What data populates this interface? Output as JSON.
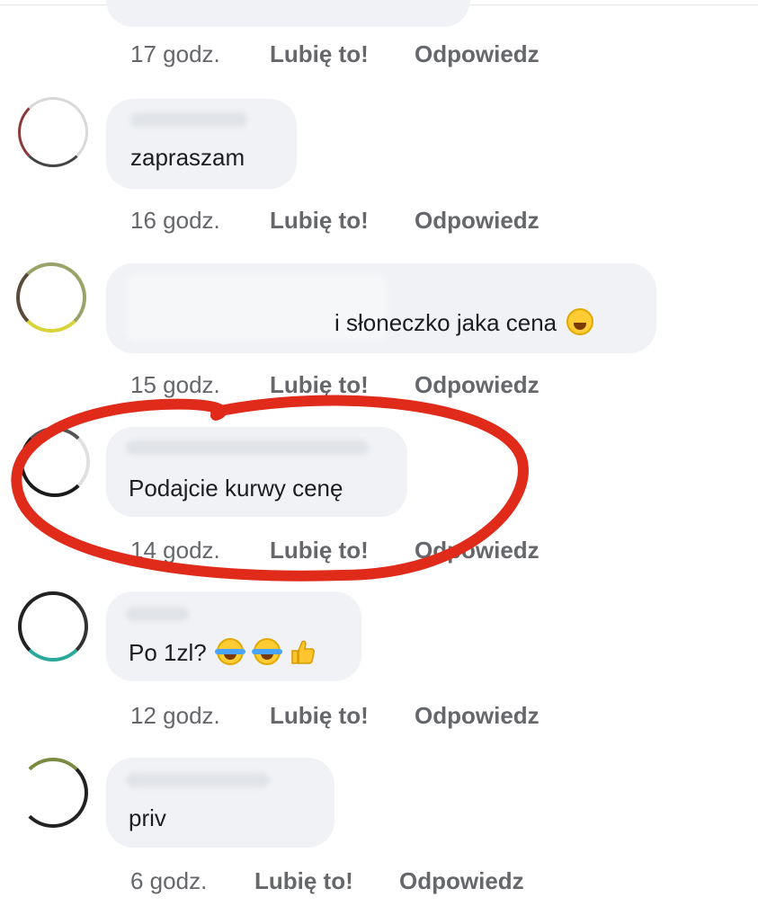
{
  "actions": {
    "like": "Lubię to!",
    "reply": "Odpowiedz"
  },
  "comments": [
    {
      "text": "",
      "time": "17 godz."
    },
    {
      "text": "zapraszam",
      "time": "16 godz."
    },
    {
      "text": "i słoneczko jaka cena",
      "emoji": "sweat-smile-emoji",
      "time": "15 godz."
    },
    {
      "text": "Podajcie kurwy cenę",
      "time": "14 godz.",
      "highlighted": true
    },
    {
      "text": "Po 1zl?",
      "emoji": [
        "tears-of-joy-emoji",
        "tears-of-joy-emoji",
        "thumbs-up-emoji"
      ],
      "time": "12 godz."
    },
    {
      "text": "priv",
      "time": "6 godz."
    }
  ],
  "colors": {
    "bubble": "#f0f2f5",
    "meta_text": "#65676b",
    "annotation": "#e02a1a"
  }
}
